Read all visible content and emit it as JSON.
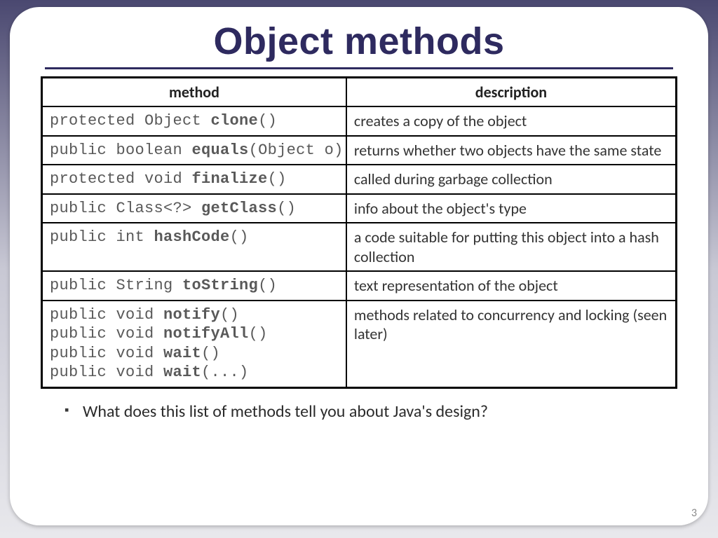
{
  "title": "Object methods",
  "headers": {
    "method": "method",
    "description": "description"
  },
  "rows": [
    {
      "sig": [
        {
          "prefix": "protected Object ",
          "name": "clone",
          "suffix": "()"
        }
      ],
      "desc": "creates a copy of the object"
    },
    {
      "sig": [
        {
          "prefix": "public boolean ",
          "name": "equals",
          "suffix": "(Object o)"
        }
      ],
      "desc": "returns whether two objects have the same state"
    },
    {
      "sig": [
        {
          "prefix": "protected void ",
          "name": "finalize",
          "suffix": "()"
        }
      ],
      "desc": "called during garbage collection"
    },
    {
      "sig": [
        {
          "prefix": "public Class<?> ",
          "name": "getClass",
          "suffix": "()"
        }
      ],
      "desc": "info about the object's type"
    },
    {
      "sig": [
        {
          "prefix": "public int ",
          "name": "hashCode",
          "suffix": "()"
        }
      ],
      "desc": "a code suitable for putting this object into a hash collection"
    },
    {
      "sig": [
        {
          "prefix": "public String ",
          "name": "toString",
          "suffix": "()"
        }
      ],
      "desc": "text representation of the object"
    },
    {
      "sig": [
        {
          "prefix": "public void ",
          "name": "notify",
          "suffix": "()"
        },
        {
          "prefix": "public void ",
          "name": "notifyAll",
          "suffix": "()"
        },
        {
          "prefix": "public void ",
          "name": "wait",
          "suffix": "()"
        },
        {
          "prefix": "public void ",
          "name": "wait",
          "suffix": "(...)"
        }
      ],
      "desc": "methods related to concurrency and locking  (seen later)"
    }
  ],
  "bullet": "What does this list of methods tell you about Java's design?",
  "page_number": "3"
}
